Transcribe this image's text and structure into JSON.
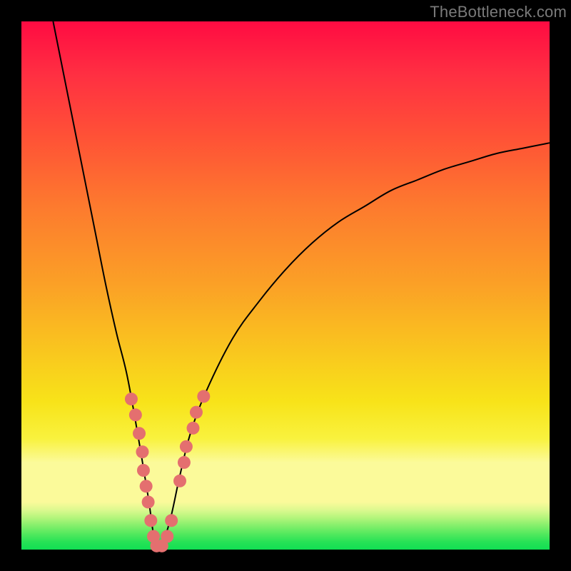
{
  "watermark": "TheBottleneck.com",
  "colors": {
    "dot": "#e46f6f",
    "curve": "#000000",
    "frame": "#000000"
  },
  "chart_data": {
    "type": "line",
    "title": "",
    "xlabel": "",
    "ylabel": "",
    "xlim": [
      0,
      100
    ],
    "ylim": [
      0,
      100
    ],
    "grid": false,
    "legend": false,
    "series": [
      {
        "name": "bottleneck-curve",
        "x": [
          6,
          8,
          10,
          12,
          14,
          16,
          18,
          20,
          22,
          24,
          25,
          26,
          28,
          30,
          32,
          35,
          40,
          45,
          50,
          55,
          60,
          65,
          70,
          75,
          80,
          85,
          90,
          95,
          100
        ],
        "y": [
          100,
          90,
          80,
          70,
          60,
          50,
          41,
          33,
          22,
          10,
          3,
          0,
          5,
          14,
          22,
          30,
          40,
          47,
          53,
          58,
          62,
          65,
          68,
          70,
          72,
          73.5,
          75,
          76,
          77
        ]
      }
    ],
    "markers": [
      {
        "x": 20.8,
        "y": 28.5
      },
      {
        "x": 21.6,
        "y": 25.5
      },
      {
        "x": 22.3,
        "y": 22.0
      },
      {
        "x": 22.9,
        "y": 18.5
      },
      {
        "x": 23.1,
        "y": 15.0
      },
      {
        "x": 23.6,
        "y": 12.0
      },
      {
        "x": 24.0,
        "y": 9.0
      },
      {
        "x": 24.5,
        "y": 5.5
      },
      {
        "x": 25.0,
        "y": 2.5
      },
      {
        "x": 25.6,
        "y": 0.7
      },
      {
        "x": 26.6,
        "y": 0.7
      },
      {
        "x": 27.6,
        "y": 2.5
      },
      {
        "x": 28.4,
        "y": 5.5
      },
      {
        "x": 30.0,
        "y": 13.0
      },
      {
        "x": 30.8,
        "y": 16.5
      },
      {
        "x": 31.2,
        "y": 19.5
      },
      {
        "x": 32.5,
        "y": 23.0
      },
      {
        "x": 33.1,
        "y": 26.0
      },
      {
        "x": 34.5,
        "y": 29.0
      }
    ]
  }
}
